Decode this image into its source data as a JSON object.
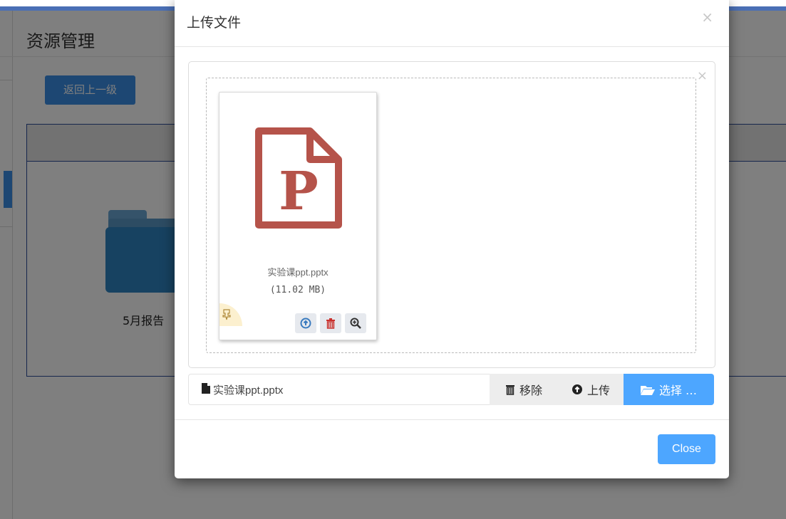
{
  "background": {
    "page_title": "资源管理",
    "back_button": "返回上一级",
    "folder_label": "5月报告"
  },
  "modal": {
    "title": "上传文件",
    "close_x": "×",
    "file_input": {
      "box_close": "×",
      "preview": {
        "file_name": "实验课ppt.pptx",
        "file_size": "(11.02 MB)",
        "icon": "ppt-file-icon",
        "icon_letter": "P"
      },
      "caption": "实验课ppt.pptx",
      "buttons": {
        "remove": "移除",
        "upload": "上传",
        "select": "选择 …"
      }
    },
    "footer": {
      "close_label": "Close"
    }
  },
  "colors": {
    "accent": "#4da6ff",
    "ppt_icon": "#b5534a",
    "topbar": "#4a6fb5"
  }
}
